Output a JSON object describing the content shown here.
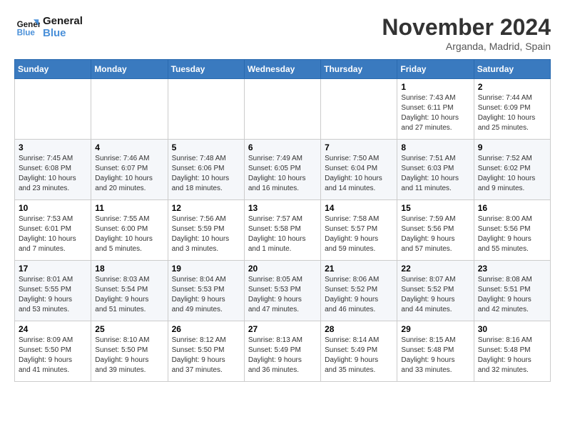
{
  "logo": {
    "line1": "General",
    "line2": "Blue"
  },
  "title": "November 2024",
  "location": "Arganda, Madrid, Spain",
  "days_of_week": [
    "Sunday",
    "Monday",
    "Tuesday",
    "Wednesday",
    "Thursday",
    "Friday",
    "Saturday"
  ],
  "weeks": [
    [
      {
        "day": "",
        "info": ""
      },
      {
        "day": "",
        "info": ""
      },
      {
        "day": "",
        "info": ""
      },
      {
        "day": "",
        "info": ""
      },
      {
        "day": "",
        "info": ""
      },
      {
        "day": "1",
        "info": "Sunrise: 7:43 AM\nSunset: 6:11 PM\nDaylight: 10 hours\nand 27 minutes."
      },
      {
        "day": "2",
        "info": "Sunrise: 7:44 AM\nSunset: 6:09 PM\nDaylight: 10 hours\nand 25 minutes."
      }
    ],
    [
      {
        "day": "3",
        "info": "Sunrise: 7:45 AM\nSunset: 6:08 PM\nDaylight: 10 hours\nand 23 minutes."
      },
      {
        "day": "4",
        "info": "Sunrise: 7:46 AM\nSunset: 6:07 PM\nDaylight: 10 hours\nand 20 minutes."
      },
      {
        "day": "5",
        "info": "Sunrise: 7:48 AM\nSunset: 6:06 PM\nDaylight: 10 hours\nand 18 minutes."
      },
      {
        "day": "6",
        "info": "Sunrise: 7:49 AM\nSunset: 6:05 PM\nDaylight: 10 hours\nand 16 minutes."
      },
      {
        "day": "7",
        "info": "Sunrise: 7:50 AM\nSunset: 6:04 PM\nDaylight: 10 hours\nand 14 minutes."
      },
      {
        "day": "8",
        "info": "Sunrise: 7:51 AM\nSunset: 6:03 PM\nDaylight: 10 hours\nand 11 minutes."
      },
      {
        "day": "9",
        "info": "Sunrise: 7:52 AM\nSunset: 6:02 PM\nDaylight: 10 hours\nand 9 minutes."
      }
    ],
    [
      {
        "day": "10",
        "info": "Sunrise: 7:53 AM\nSunset: 6:01 PM\nDaylight: 10 hours\nand 7 minutes."
      },
      {
        "day": "11",
        "info": "Sunrise: 7:55 AM\nSunset: 6:00 PM\nDaylight: 10 hours\nand 5 minutes."
      },
      {
        "day": "12",
        "info": "Sunrise: 7:56 AM\nSunset: 5:59 PM\nDaylight: 10 hours\nand 3 minutes."
      },
      {
        "day": "13",
        "info": "Sunrise: 7:57 AM\nSunset: 5:58 PM\nDaylight: 10 hours\nand 1 minute."
      },
      {
        "day": "14",
        "info": "Sunrise: 7:58 AM\nSunset: 5:57 PM\nDaylight: 9 hours\nand 59 minutes."
      },
      {
        "day": "15",
        "info": "Sunrise: 7:59 AM\nSunset: 5:56 PM\nDaylight: 9 hours\nand 57 minutes."
      },
      {
        "day": "16",
        "info": "Sunrise: 8:00 AM\nSunset: 5:56 PM\nDaylight: 9 hours\nand 55 minutes."
      }
    ],
    [
      {
        "day": "17",
        "info": "Sunrise: 8:01 AM\nSunset: 5:55 PM\nDaylight: 9 hours\nand 53 minutes."
      },
      {
        "day": "18",
        "info": "Sunrise: 8:03 AM\nSunset: 5:54 PM\nDaylight: 9 hours\nand 51 minutes."
      },
      {
        "day": "19",
        "info": "Sunrise: 8:04 AM\nSunset: 5:53 PM\nDaylight: 9 hours\nand 49 minutes."
      },
      {
        "day": "20",
        "info": "Sunrise: 8:05 AM\nSunset: 5:53 PM\nDaylight: 9 hours\nand 47 minutes."
      },
      {
        "day": "21",
        "info": "Sunrise: 8:06 AM\nSunset: 5:52 PM\nDaylight: 9 hours\nand 46 minutes."
      },
      {
        "day": "22",
        "info": "Sunrise: 8:07 AM\nSunset: 5:52 PM\nDaylight: 9 hours\nand 44 minutes."
      },
      {
        "day": "23",
        "info": "Sunrise: 8:08 AM\nSunset: 5:51 PM\nDaylight: 9 hours\nand 42 minutes."
      }
    ],
    [
      {
        "day": "24",
        "info": "Sunrise: 8:09 AM\nSunset: 5:50 PM\nDaylight: 9 hours\nand 41 minutes."
      },
      {
        "day": "25",
        "info": "Sunrise: 8:10 AM\nSunset: 5:50 PM\nDaylight: 9 hours\nand 39 minutes."
      },
      {
        "day": "26",
        "info": "Sunrise: 8:12 AM\nSunset: 5:50 PM\nDaylight: 9 hours\nand 37 minutes."
      },
      {
        "day": "27",
        "info": "Sunrise: 8:13 AM\nSunset: 5:49 PM\nDaylight: 9 hours\nand 36 minutes."
      },
      {
        "day": "28",
        "info": "Sunrise: 8:14 AM\nSunset: 5:49 PM\nDaylight: 9 hours\nand 35 minutes."
      },
      {
        "day": "29",
        "info": "Sunrise: 8:15 AM\nSunset: 5:48 PM\nDaylight: 9 hours\nand 33 minutes."
      },
      {
        "day": "30",
        "info": "Sunrise: 8:16 AM\nSunset: 5:48 PM\nDaylight: 9 hours\nand 32 minutes."
      }
    ]
  ]
}
